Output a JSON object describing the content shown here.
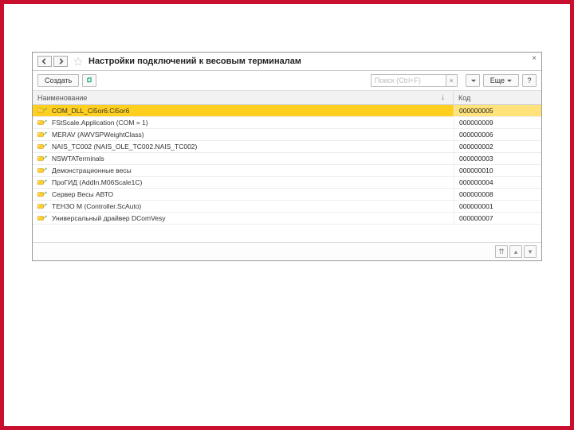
{
  "title": "Настройки подключений к весовым терминалам",
  "toolbar": {
    "create_label": "Создать",
    "more_label": "Еще",
    "help_label": "?"
  },
  "search": {
    "placeholder": "Поиск (Ctrl+F)",
    "clear_label": "×"
  },
  "columns": {
    "name": "Наименование",
    "code": "Код",
    "sort_indicator": "↓"
  },
  "rows": [
    {
      "name": "COM_DLL_Ci5or6.Ci5or6",
      "code": "000000005",
      "selected": true
    },
    {
      "name": "FStScale.Application (COM = 1)",
      "code": "000000009",
      "selected": false
    },
    {
      "name": "MERAV (AWVSPWeightClass)",
      "code": "000000006",
      "selected": false
    },
    {
      "name": "NAIS_TC002 (NAIS_OLE_TC002.NAIS_TC002)",
      "code": "000000002",
      "selected": false
    },
    {
      "name": "NSWTATerminals",
      "code": "000000003",
      "selected": false
    },
    {
      "name": "Демонстрационные весы",
      "code": "000000010",
      "selected": false
    },
    {
      "name": "ПроГИД (AddIn.M06Scale1C)",
      "code": "000000004",
      "selected": false
    },
    {
      "name": "Сервер Весы АВТО",
      "code": "000000008",
      "selected": false
    },
    {
      "name": "ТЕНЗО М (Controller.ScAuto)",
      "code": "000000001",
      "selected": false
    },
    {
      "name": "Универсальный драйвер DComVesy",
      "code": "000000007",
      "selected": false
    }
  ],
  "footer": {
    "first": "⇈",
    "up": "▴",
    "down": "▾"
  },
  "close_label": "×"
}
